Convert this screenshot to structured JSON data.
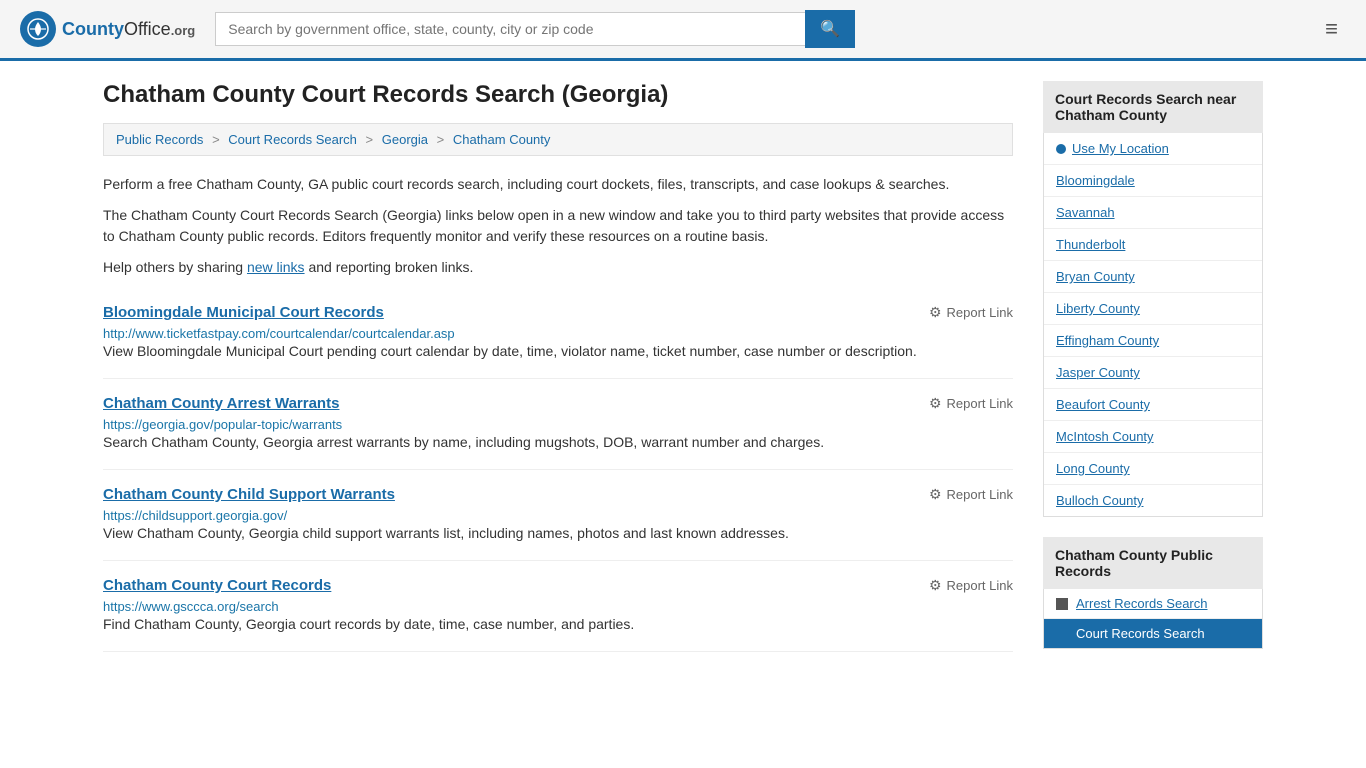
{
  "header": {
    "logo_text": "County",
    "logo_org": "Office",
    "logo_domain": ".org",
    "search_placeholder": "Search by government office, state, county, city or zip code",
    "search_button_label": "🔍",
    "menu_icon": "≡"
  },
  "page": {
    "title": "Chatham County Court Records Search (Georgia)",
    "breadcrumbs": [
      {
        "label": "Public Records",
        "href": "#"
      },
      {
        "label": "Court Records Search",
        "href": "#"
      },
      {
        "label": "Georgia",
        "href": "#"
      },
      {
        "label": "Chatham County",
        "href": "#"
      }
    ],
    "description1": "Perform a free Chatham County, GA public court records search, including court dockets, files, transcripts, and case lookups & searches.",
    "description2": "The Chatham County Court Records Search (Georgia) links below open in a new window and take you to third party websites that provide access to Chatham County public records. Editors frequently monitor and verify these resources on a routine basis.",
    "description3_pre": "Help others by sharing ",
    "description3_link": "new links",
    "description3_post": " and reporting broken links.",
    "records": [
      {
        "title": "Bloomingdale Municipal Court Records",
        "url": "http://www.ticketfastpay.com/courtcalendar/courtcalendar.asp",
        "description": "View Bloomingdale Municipal Court pending court calendar by date, time, violator name, ticket number, case number or description.",
        "report_label": "Report Link"
      },
      {
        "title": "Chatham County Arrest Warrants",
        "url": "https://georgia.gov/popular-topic/warrants",
        "description": "Search Chatham County, Georgia arrest warrants by name, including mugshots, DOB, warrant number and charges.",
        "report_label": "Report Link"
      },
      {
        "title": "Chatham County Child Support Warrants",
        "url": "https://childsupport.georgia.gov/",
        "description": "View Chatham County, Georgia child support warrants list, including names, photos and last known addresses.",
        "report_label": "Report Link"
      },
      {
        "title": "Chatham County Court Records",
        "url": "https://www.gsccca.org/search",
        "description": "Find Chatham County, Georgia court records by date, time, case number, and parties.",
        "report_label": "Report Link"
      }
    ]
  },
  "sidebar": {
    "nearby_header": "Court Records Search near Chatham County",
    "use_location_label": "Use My Location",
    "nearby_items": [
      {
        "label": "Bloomingdale"
      },
      {
        "label": "Savannah"
      },
      {
        "label": "Thunderbolt"
      },
      {
        "label": "Bryan County"
      },
      {
        "label": "Liberty County"
      },
      {
        "label": "Effingham County"
      },
      {
        "label": "Jasper County"
      },
      {
        "label": "Beaufort County"
      },
      {
        "label": "McIntosh County"
      },
      {
        "label": "Long County"
      },
      {
        "label": "Bulloch County"
      }
    ],
    "public_records_header": "Chatham County Public Records",
    "public_records_items": [
      {
        "label": "Arrest Records Search",
        "active": false
      },
      {
        "label": "Court Records Search",
        "active": true
      }
    ]
  }
}
